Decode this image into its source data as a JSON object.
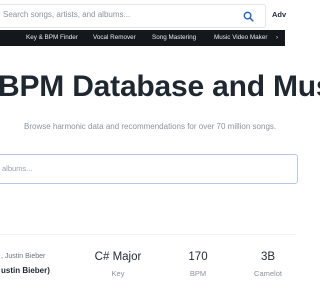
{
  "header": {
    "search_placeholder": "Search songs, artists, and albums...",
    "advanced_label": "Adv"
  },
  "nav": {
    "items": [
      "Key & BPM Finder",
      "Vocal Remover",
      "Song Mastering",
      "Music Video Maker"
    ],
    "caret": "›"
  },
  "hero": {
    "title": "BPM Database and Mus",
    "subtitle": "Browse harmonic data and recommendations for over 70 million songs."
  },
  "main_search": {
    "placeholder": "albums..."
  },
  "result": {
    "artist": ", Justin Bieber",
    "song": "ustin Bieber)",
    "key_value": "C# Major",
    "key_label": "Key",
    "bpm_value": "170",
    "bpm_label": "BPM",
    "camelot_value": "3B",
    "camelot_label": "Camelot"
  },
  "colors": {
    "nav_background": "#14171c",
    "search_accent": "#1f5fd6",
    "main_search_border": "#b8c6e8"
  },
  "icons": [
    "search-icon"
  ]
}
